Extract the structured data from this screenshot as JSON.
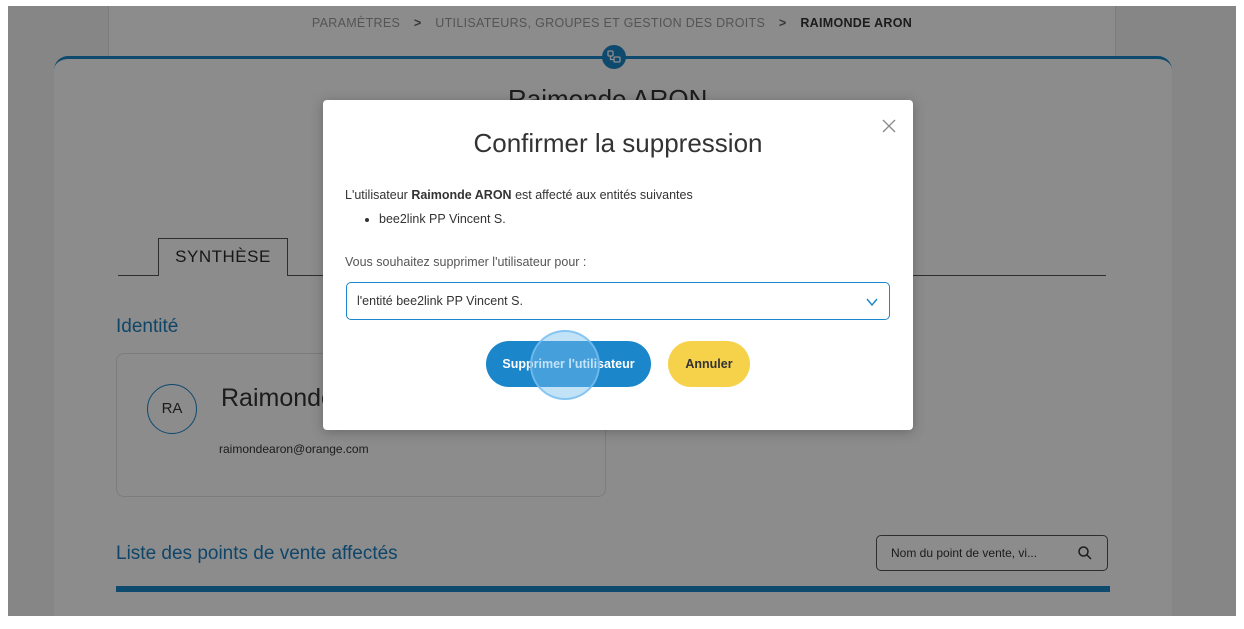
{
  "breadcrumb": {
    "item1": "PARAMÈTRES",
    "item2": "UTILISATEURS, GROUPES ET GESTION DES DROITS",
    "current": "RAIMONDE ARON",
    "separator": ">"
  },
  "header_icon": "users-group-icon",
  "user": {
    "title": "Raimonde ARON",
    "initials": "RA",
    "name_visible": "Raimonde",
    "email": "raimondearon@orange.com"
  },
  "tabs": [
    {
      "label": "SYNTHÈSE"
    }
  ],
  "sections": {
    "identity": "Identité",
    "points_of_sale": "Liste des points de vente affectés"
  },
  "search": {
    "placeholder": "Nom du point de vente, vi...",
    "icon": "search-icon"
  },
  "modal": {
    "title": "Confirmer la suppression",
    "text_prefix": "L'utilisateur",
    "text_user": "Raimonde ARON",
    "text_suffix": "est affecté aux entités suivantes",
    "entities": [
      "bee2link PP Vincent S."
    ],
    "question": "Vous souhaitez supprimer l'utilisateur pour :",
    "select_value": "l'entité bee2link PP Vincent S.",
    "confirm_label": "Supprimer l'utilisateur",
    "cancel_label": "Annuler"
  },
  "colors": {
    "accent": "#1b86c9",
    "cancel": "#f6d24a"
  }
}
